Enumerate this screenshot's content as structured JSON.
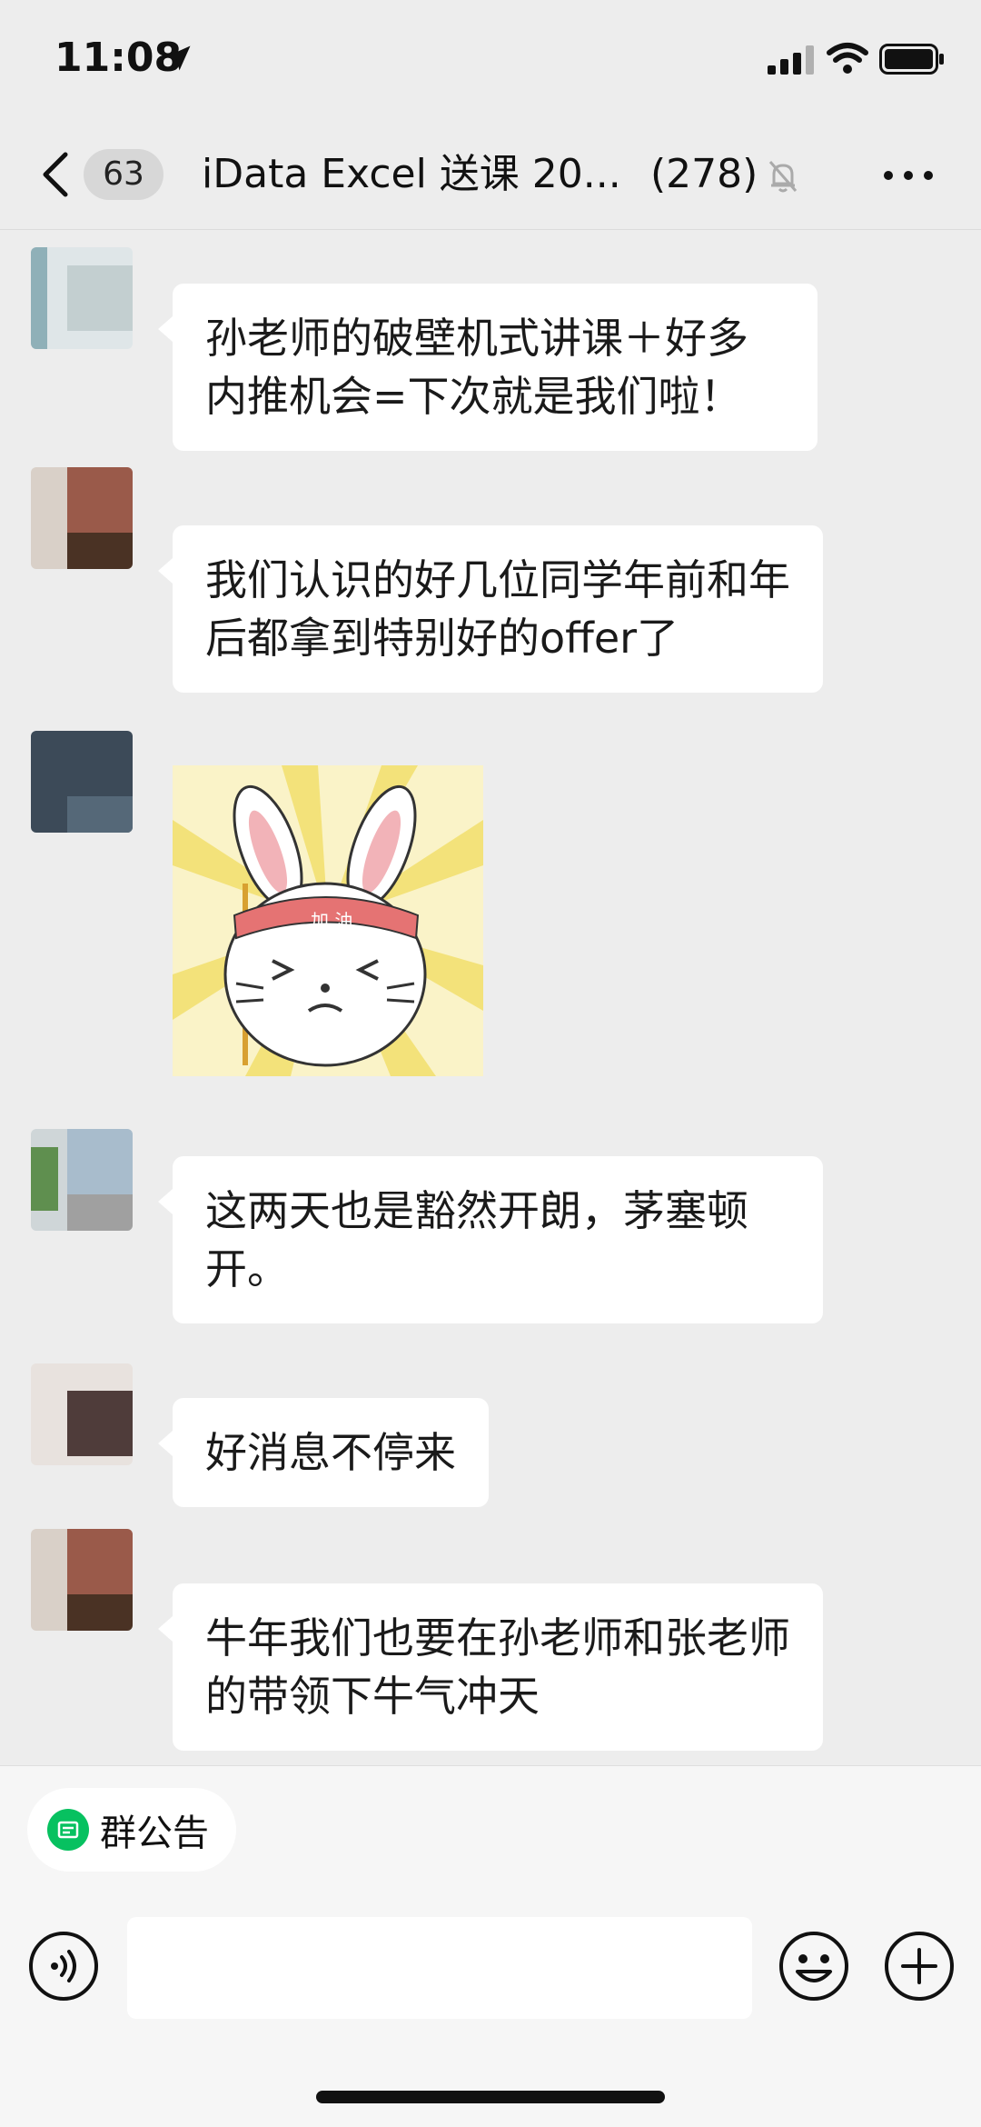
{
  "status_bar": {
    "time": "11:08"
  },
  "nav": {
    "unread_badge": "63",
    "title": "iData Excel 送课 20...",
    "member_count": "(278)"
  },
  "messages": [
    {
      "sender": "",
      "text": "孙老师的破壁机式讲课＋好多内推机会=下次就是我们啦！"
    },
    {
      "sender": "",
      "text": "我们认识的好几位同学年前和年后都拿到特别好的offer了"
    },
    {
      "sender": "",
      "type": "sticker",
      "sticker_text": "加 油"
    },
    {
      "sender": "",
      "text": "这两天也是豁然开朗，茅塞顿开。"
    },
    {
      "sender": "",
      "text": "好消息不停来"
    },
    {
      "sender": "",
      "text": "牛年我们也要在孙老师和张老师的带领下牛气冲天"
    }
  ],
  "bottom_bar": {
    "notice_label": "群公告",
    "input_value": ""
  },
  "colors": {
    "background": "#ededed",
    "bubble": "#ffffff",
    "accent_green": "#07c160"
  },
  "icons": [
    "location-arrow-icon",
    "signal-icon",
    "wifi-icon",
    "battery-icon",
    "back-chevron-icon",
    "mute-bell-icon",
    "more-icon",
    "notice-icon",
    "voice-icon",
    "emoji-icon",
    "plus-icon"
  ]
}
